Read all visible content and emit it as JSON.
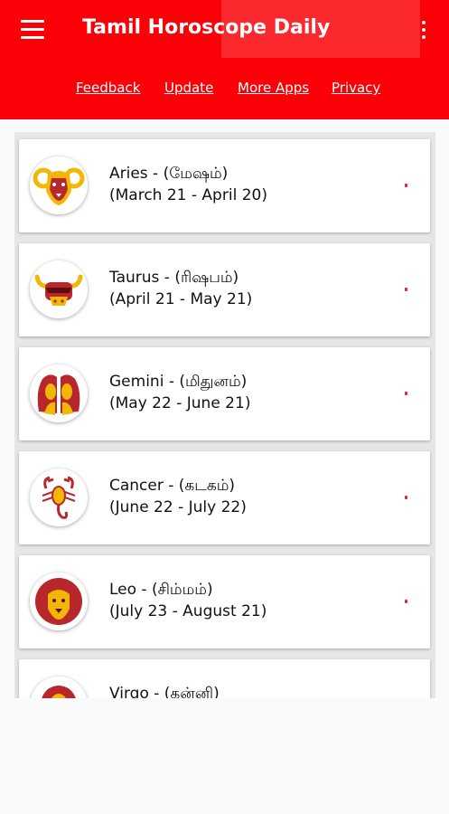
{
  "app": {
    "title": "Tamil Horoscope Daily",
    "menu_icon": "hamburger-menu-icon",
    "overflow_icon": "more-vert-icon",
    "accent_color": "#fb0006"
  },
  "links": [
    "Feedback",
    "Update",
    "More Apps",
    "Privacy"
  ],
  "signs": [
    {
      "name": "Aries - (மேஷம்)",
      "dates": "(March 21 - April 20)",
      "icon": "aries-ram-icon"
    },
    {
      "name": "Taurus - (ரிஷபம்)",
      "dates": "(April 21 - May 21)",
      "icon": "taurus-bull-icon"
    },
    {
      "name": "Gemini - (மிதுனம்)",
      "dates": "(May 22 - June 21)",
      "icon": "gemini-twins-icon"
    },
    {
      "name": "Cancer - (கடகம்)",
      "dates": "(June 22 - July 22)",
      "icon": "cancer-scorpion-icon"
    },
    {
      "name": "Leo - (சிம்மம்)",
      "dates": "(July 23 - August 21)",
      "icon": "leo-lion-icon"
    },
    {
      "name": "Virgo - (கன்னி)",
      "dates": "",
      "icon": "virgo-maiden-icon"
    }
  ]
}
